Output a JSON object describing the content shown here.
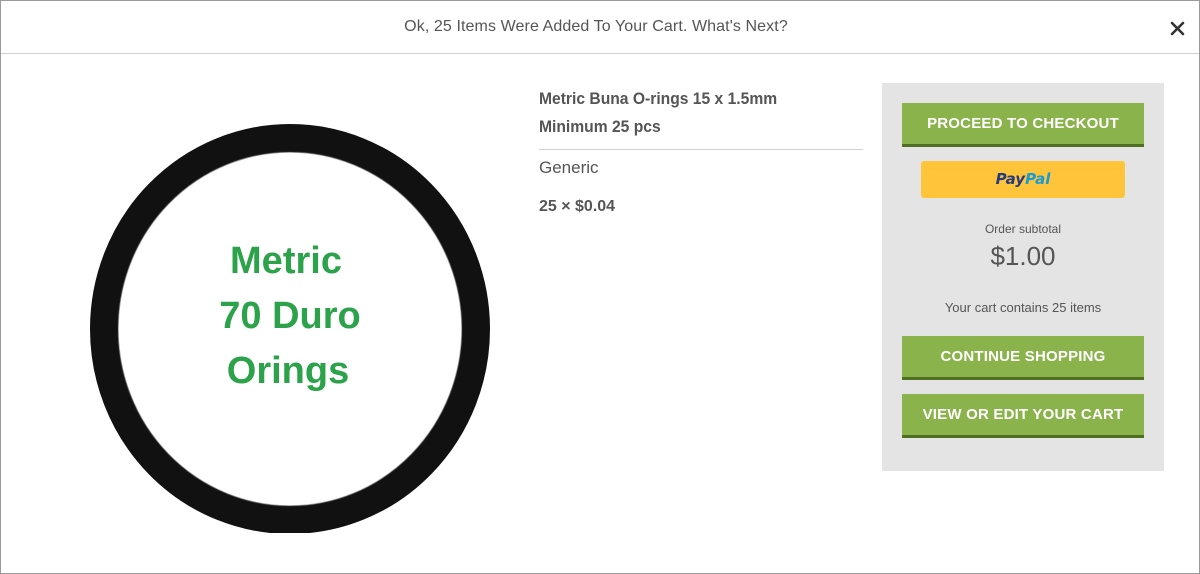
{
  "header": {
    "message": "Ok, 25 Items Were Added To Your Cart. What's Next?",
    "close_icon": "close-icon"
  },
  "product": {
    "image": {
      "line1": "Metric",
      "line2": "70 Duro",
      "line3": "Orings",
      "text_color": "#2ca24a",
      "ring_color": "#111111"
    },
    "title_line1": "Metric Buna O-rings 15 x 1.5mm",
    "title_line2": "Minimum 25 pcs",
    "brand": "Generic",
    "qty_price": "25 × $0.04"
  },
  "cart_panel": {
    "checkout_label": "PROCEED TO CHECKOUT",
    "paypal_pay": "Pay",
    "paypal_pal": "Pal",
    "subtotal_label": "Order subtotal",
    "subtotal_amount": "$1.00",
    "cart_count": "Your cart contains 25 items",
    "continue_label": "CONTINUE SHOPPING",
    "view_cart_label": "VIEW OR EDIT YOUR CART"
  },
  "colors": {
    "button_green": "#8ab34c",
    "button_green_border": "#4f6f22",
    "paypal_yellow": "#ffc439",
    "panel_bg": "#e4e4e4"
  }
}
